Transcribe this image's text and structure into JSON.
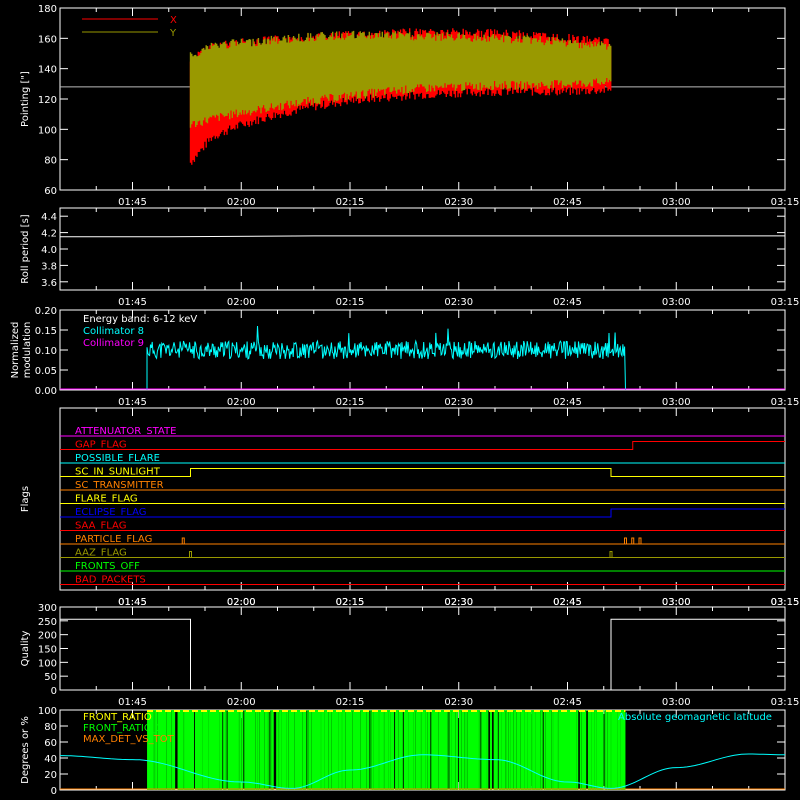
{
  "time_ticks": [
    "01:45",
    "02:00",
    "02:15",
    "02:30",
    "02:45",
    "03:00",
    "03:15"
  ],
  "chart_data": [
    {
      "type": "line",
      "ylabel": "Pointing [\"]",
      "ylim": [
        60,
        180
      ],
      "yticks": [
        "60",
        "80",
        "100",
        "120",
        "140",
        "160",
        "180"
      ],
      "legend_position": "top-left",
      "reference_line": 128,
      "data_window": [
        "01:53",
        "02:51"
      ],
      "series": [
        {
          "name": "X",
          "color": "#ff0000",
          "x": [
            "01:53",
            "01:56",
            "02:00",
            "02:05",
            "02:10",
            "02:15",
            "02:20",
            "02:25",
            "02:30",
            "02:35",
            "02:40",
            "02:45",
            "02:51"
          ],
          "y_min": [
            75,
            92,
            100,
            107,
            112,
            116,
            118,
            120,
            121,
            122,
            122,
            122,
            123
          ],
          "y_max": [
            148,
            158,
            160,
            162,
            164,
            165,
            166,
            167,
            167,
            166,
            165,
            163,
            160
          ]
        },
        {
          "name": "Y",
          "color": "#999900",
          "x": [
            "01:53",
            "01:56",
            "02:00",
            "02:05",
            "02:10",
            "02:15",
            "02:20",
            "02:25",
            "02:30",
            "02:35",
            "02:40",
            "02:45",
            "02:51"
          ],
          "y_min": [
            100,
            104,
            108,
            112,
            116,
            119,
            122,
            124,
            125,
            126,
            126,
            127,
            128
          ],
          "y_max": [
            152,
            158,
            160,
            162,
            164,
            165,
            165,
            164,
            164,
            163,
            162,
            160,
            158
          ]
        }
      ]
    },
    {
      "type": "line",
      "ylabel": "Roll period [s]",
      "ylim": [
        3.5,
        4.5
      ],
      "yticks": [
        "3.6",
        "3.8",
        "4.0",
        "4.2",
        "4.4"
      ],
      "series": [
        {
          "x": [
            "01:35",
            "01:50",
            "02:10",
            "02:30",
            "02:50",
            "03:15"
          ],
          "y": [
            4.15,
            4.15,
            4.16,
            4.16,
            4.16,
            4.16
          ],
          "color": "#ffffff"
        }
      ]
    },
    {
      "type": "line",
      "ylabel": "Normalized modulation",
      "ylim": [
        0.0,
        0.2
      ],
      "yticks": [
        "0.00",
        "0.05",
        "0.10",
        "0.15",
        "0.20"
      ],
      "annotation": "Energy band: 6-12 keV",
      "legend_position": "top-left",
      "data_window": [
        "01:47",
        "02:53"
      ],
      "series": [
        {
          "name": "Collimator 8",
          "color": "#00ffff",
          "mean": 0.1,
          "range": [
            0.06,
            0.16
          ]
        },
        {
          "name": "Collimator 9",
          "color": "#ff00ff",
          "constant": 0.0
        }
      ]
    },
    {
      "type": "flags",
      "ylabel": "Flags",
      "flags": [
        {
          "name": "ATTENUATOR_STATE",
          "color": "#ff00ff",
          "steps": []
        },
        {
          "name": "GAP_FLAG",
          "color": "#ff0000",
          "steps": [
            [
              "02:54",
              1
            ]
          ]
        },
        {
          "name": "POSSIBLE_FLARE",
          "color": "#00ffff",
          "steps": []
        },
        {
          "name": "SC_IN_SUNLIGHT",
          "color": "#ffff00",
          "steps": [
            [
              "01:53",
              1
            ],
            [
              "02:51",
              0
            ]
          ]
        },
        {
          "name": "SC_TRANSMITTER",
          "color": "#ff8000",
          "steps": []
        },
        {
          "name": "FLARE_FLAG",
          "color": "#ffff00",
          "steps": []
        },
        {
          "name": "ECLIPSE_FLAG",
          "color": "#0000ff",
          "steps": [
            [
              "01:53",
              0
            ],
            [
              "02:51",
              1
            ]
          ]
        },
        {
          "name": "SAA_FLAG",
          "color": "#ff0000",
          "steps": []
        },
        {
          "name": "PARTICLE_FLAG",
          "color": "#ff8000",
          "steps": []
        },
        {
          "name": "AAZ_FLAG",
          "color": "#999900",
          "steps": []
        },
        {
          "name": "FRONTS_OFF",
          "color": "#00ff00",
          "steps": []
        },
        {
          "name": "BAD_PACKETS",
          "color": "#ff0000",
          "steps": []
        }
      ]
    },
    {
      "type": "line",
      "ylabel": "Quality",
      "ylim": [
        0,
        300
      ],
      "yticks": [
        "0",
        "50",
        "100",
        "150",
        "200",
        "250",
        "300"
      ],
      "series": [
        {
          "x": [
            "01:35",
            "01:53",
            "01:53",
            "02:51",
            "02:51",
            "03:15"
          ],
          "y": [
            256,
            256,
            0,
            0,
            256,
            256
          ],
          "color": "#ffffff"
        }
      ]
    },
    {
      "type": "line",
      "ylabel": "Degrees or %",
      "ylim": [
        0,
        100
      ],
      "yticks": [
        "0",
        "20",
        "40",
        "60",
        "80",
        "100"
      ],
      "data_window": [
        "01:47",
        "02:53"
      ],
      "legend_position": "top-left",
      "series": [
        {
          "name": "FRONT_RATIO",
          "color": "#ffff00"
        },
        {
          "name": "FRONT_RATIO_2",
          "color": "#00ff00"
        },
        {
          "name": "MAX_DET_VS_TOT",
          "color": "#ff8000"
        },
        {
          "name": "Absolute geomagnetic latitude",
          "color": "#00ffff",
          "x": [
            "01:35",
            "01:45",
            "02:00",
            "02:07",
            "02:15",
            "02:25",
            "02:35",
            "02:45",
            "02:51",
            "03:00",
            "03:10",
            "03:15"
          ],
          "y": [
            43,
            38,
            10,
            2,
            25,
            44,
            38,
            10,
            2,
            28,
            45,
            44
          ]
        }
      ]
    }
  ]
}
